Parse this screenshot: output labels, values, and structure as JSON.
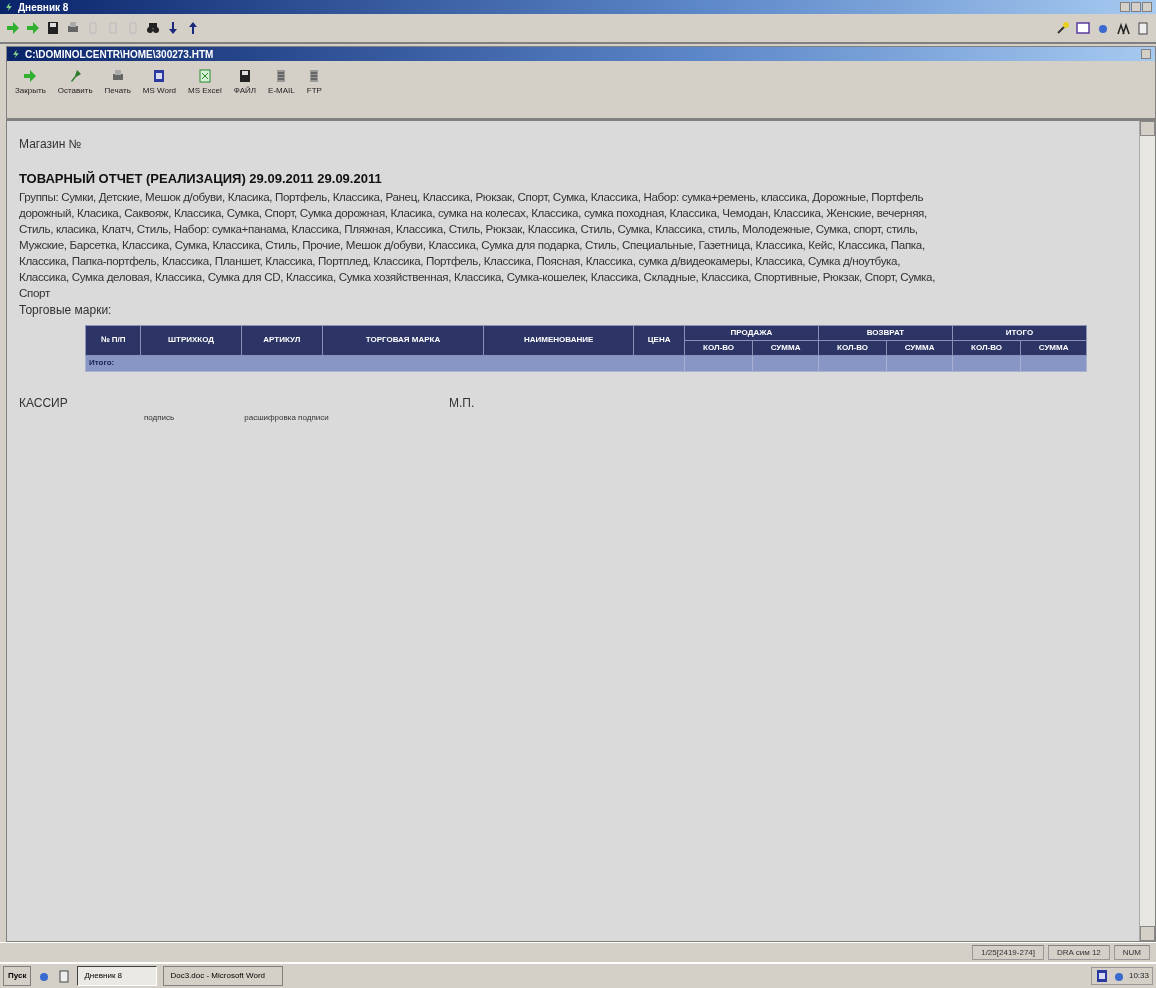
{
  "app_window": {
    "title": "Дневник 8"
  },
  "document_window": {
    "title": "C:\\DOMINOLCENTR\\HOME\\300273.HTM"
  },
  "doc_toolbar": [
    {
      "label": "Закрыть"
    },
    {
      "label": "Оставить"
    },
    {
      "label": "Печать"
    },
    {
      "label": "MS Word"
    },
    {
      "label": "MS Excel"
    },
    {
      "label": "ФАЙЛ"
    },
    {
      "label": "E-MAIL"
    },
    {
      "label": "FTP"
    }
  ],
  "report": {
    "store_label": "Магазин №",
    "heading": "ТОВАРНЫЙ ОТЧЕТ (РЕАЛИЗАЦИЯ) 29.09.2011 29.09.2011",
    "groups_lines": [
      "Группы: Сумки, Детские, Мешок д/обуви, Класика, Портфель, Классика, Ранец, Классика, Рюкзак, Спорт, Сумка, Классика, Набор: сумка+ремень, классика, Дорожные, Портфель",
      "дорожный, Класика, Саквояж, Классика, Сумка, Спорт, Сумка дорожная, Класика, сумка на колесах, Классика, сумка походная, Классика, Чемодан, Классика, Женские, вечерняя,",
      "Стиль, класика, Клатч, Стиль, Набор: сумка+панама, Классика, Пляжная, Классика, Стиль, Рюкзак, Классика, Стиль, Сумка, Классика, стиль, Молодежные, Сумка, спорт, стиль,",
      "Мужские, Барсетка, Классика, Сумка, Классика, Стиль, Прочие, Мешок д/обуви, Классика, Сумка для подарка, Стиль, Специальные, Газетница, Классика, Кейс, Классика, Папка,",
      "Классика, Папка-портфель, Классика, Планшет, Классика, Портплед, Классика, Портфель, Классика, Поясная, Классика, сумка д/видеокамеры, Классика, Сумка д/ноутбука,",
      "Классика, Сумка деловая, Классика, Сумка для CD, Классика, Сумка хозяйственная, Классика, Сумка-кошелек, Классика, Складные, Классика, Спортивные, Рюкзак, Спорт, Сумка,",
      "Спорт"
    ],
    "brands_label": "Торговые марки:",
    "table": {
      "columns": [
        "№ П/П",
        "ШТРИХКОД",
        "АРТИКУЛ",
        "ТОРГОВАЯ МАРКА",
        "НАИМЕНОВАНИЕ",
        "ЦЕНА"
      ],
      "column_groups": [
        {
          "title": "ПРОДАЖА",
          "subcolumns": [
            "КОЛ-ВО",
            "СУММА"
          ]
        },
        {
          "title": "ВОЗВРАТ",
          "subcolumns": [
            "КОЛ-ВО",
            "СУММА"
          ]
        },
        {
          "title": "ИТОГО",
          "subcolumns": [
            "КОЛ-ВО",
            "СУММА"
          ]
        }
      ],
      "total_label": "Итого:"
    },
    "cashier_label": "КАССИР",
    "stamp_label": "М.П.",
    "signature_label": "подпись",
    "signature_decode_label": "расшифровка подписи"
  },
  "status_bar": [
    "1/25[2419-274]",
    "DRA сим 12",
    "NUM"
  ],
  "taskbar": {
    "start": "Пуск",
    "tasks": [
      {
        "label": "Дневник 8",
        "selected": true
      },
      {
        "label": "Doc3.doc - Microsoft Word",
        "selected": false
      }
    ],
    "clock": "10:33"
  }
}
